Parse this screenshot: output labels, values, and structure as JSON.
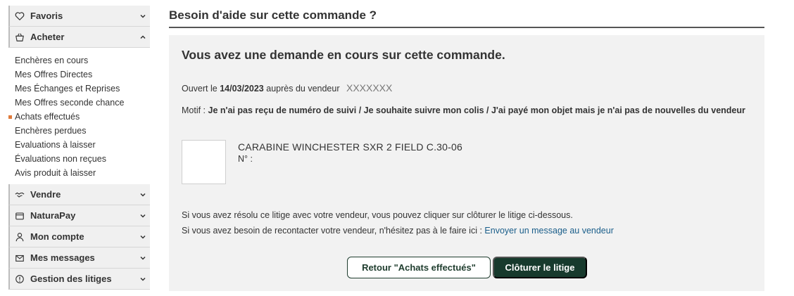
{
  "sidebar": {
    "favoris": {
      "label": "Favoris",
      "icon": "heart-icon"
    },
    "acheter": {
      "label": "Acheter",
      "icon": "basket-icon",
      "items": [
        {
          "label": "Enchères en cours"
        },
        {
          "label": "Mes Offres Directes"
        },
        {
          "label": "Mes Échanges et Reprises"
        },
        {
          "label": "Mes Offres seconde chance"
        },
        {
          "label": "Achats effectués"
        },
        {
          "label": "Enchères perdues"
        },
        {
          "label": "Evaluations à laisser"
        },
        {
          "label": "Évaluations non reçues"
        },
        {
          "label": "Avis produit à laisser"
        }
      ]
    },
    "vendre": {
      "label": "Vendre",
      "icon": "handshake-icon"
    },
    "naturapay": {
      "label": "NaturaPay",
      "icon": "wallet-icon"
    },
    "mon_compte": {
      "label": "Mon compte",
      "icon": "user-icon"
    },
    "mes_messages": {
      "label": "Mes messages",
      "icon": "envelope-icon"
    },
    "gestion_litiges": {
      "label": "Gestion des litiges",
      "icon": "alert-circle-icon"
    }
  },
  "main": {
    "title": "Besoin d'aide sur cette commande ?",
    "card": {
      "title": "Vous avez une demande en cours sur cette commande.",
      "opened_prefix": "Ouvert le",
      "opened_date": "14/03/2023",
      "opened_suffix": "auprès du vendeur",
      "seller_name": "XXXXXXX",
      "motif_prefix": "Motif :",
      "motif_text": "Je n'ai pas reçu de numéro de suivi / Je souhaite suivre mon colis / J'ai payé mon objet mais je n'ai pas de nouvelles du vendeur",
      "product_name": "CARABINE WINCHESTER SXR 2 FIELD C.30-06",
      "product_number": "N° :",
      "info_resolved": "Si vous avez résolu ce litige avec votre vendeur, vous pouvez cliquer sur clôturer le litige ci-dessous.",
      "info_contact": "Si vous avez besoin de recontacter votre vendeur, n'hésitez pas à le faire ici :",
      "contact_link": "Envoyer un message au vendeur",
      "back_button": "Retour \"Achats effectués\"",
      "close_button": "Clôturer le litige"
    }
  },
  "colors": {
    "accent_dark_green": "#173a2d",
    "active_marker": "#e07a3a",
    "link": "#1a5e8a",
    "card_bg": "#f2f2f2"
  }
}
